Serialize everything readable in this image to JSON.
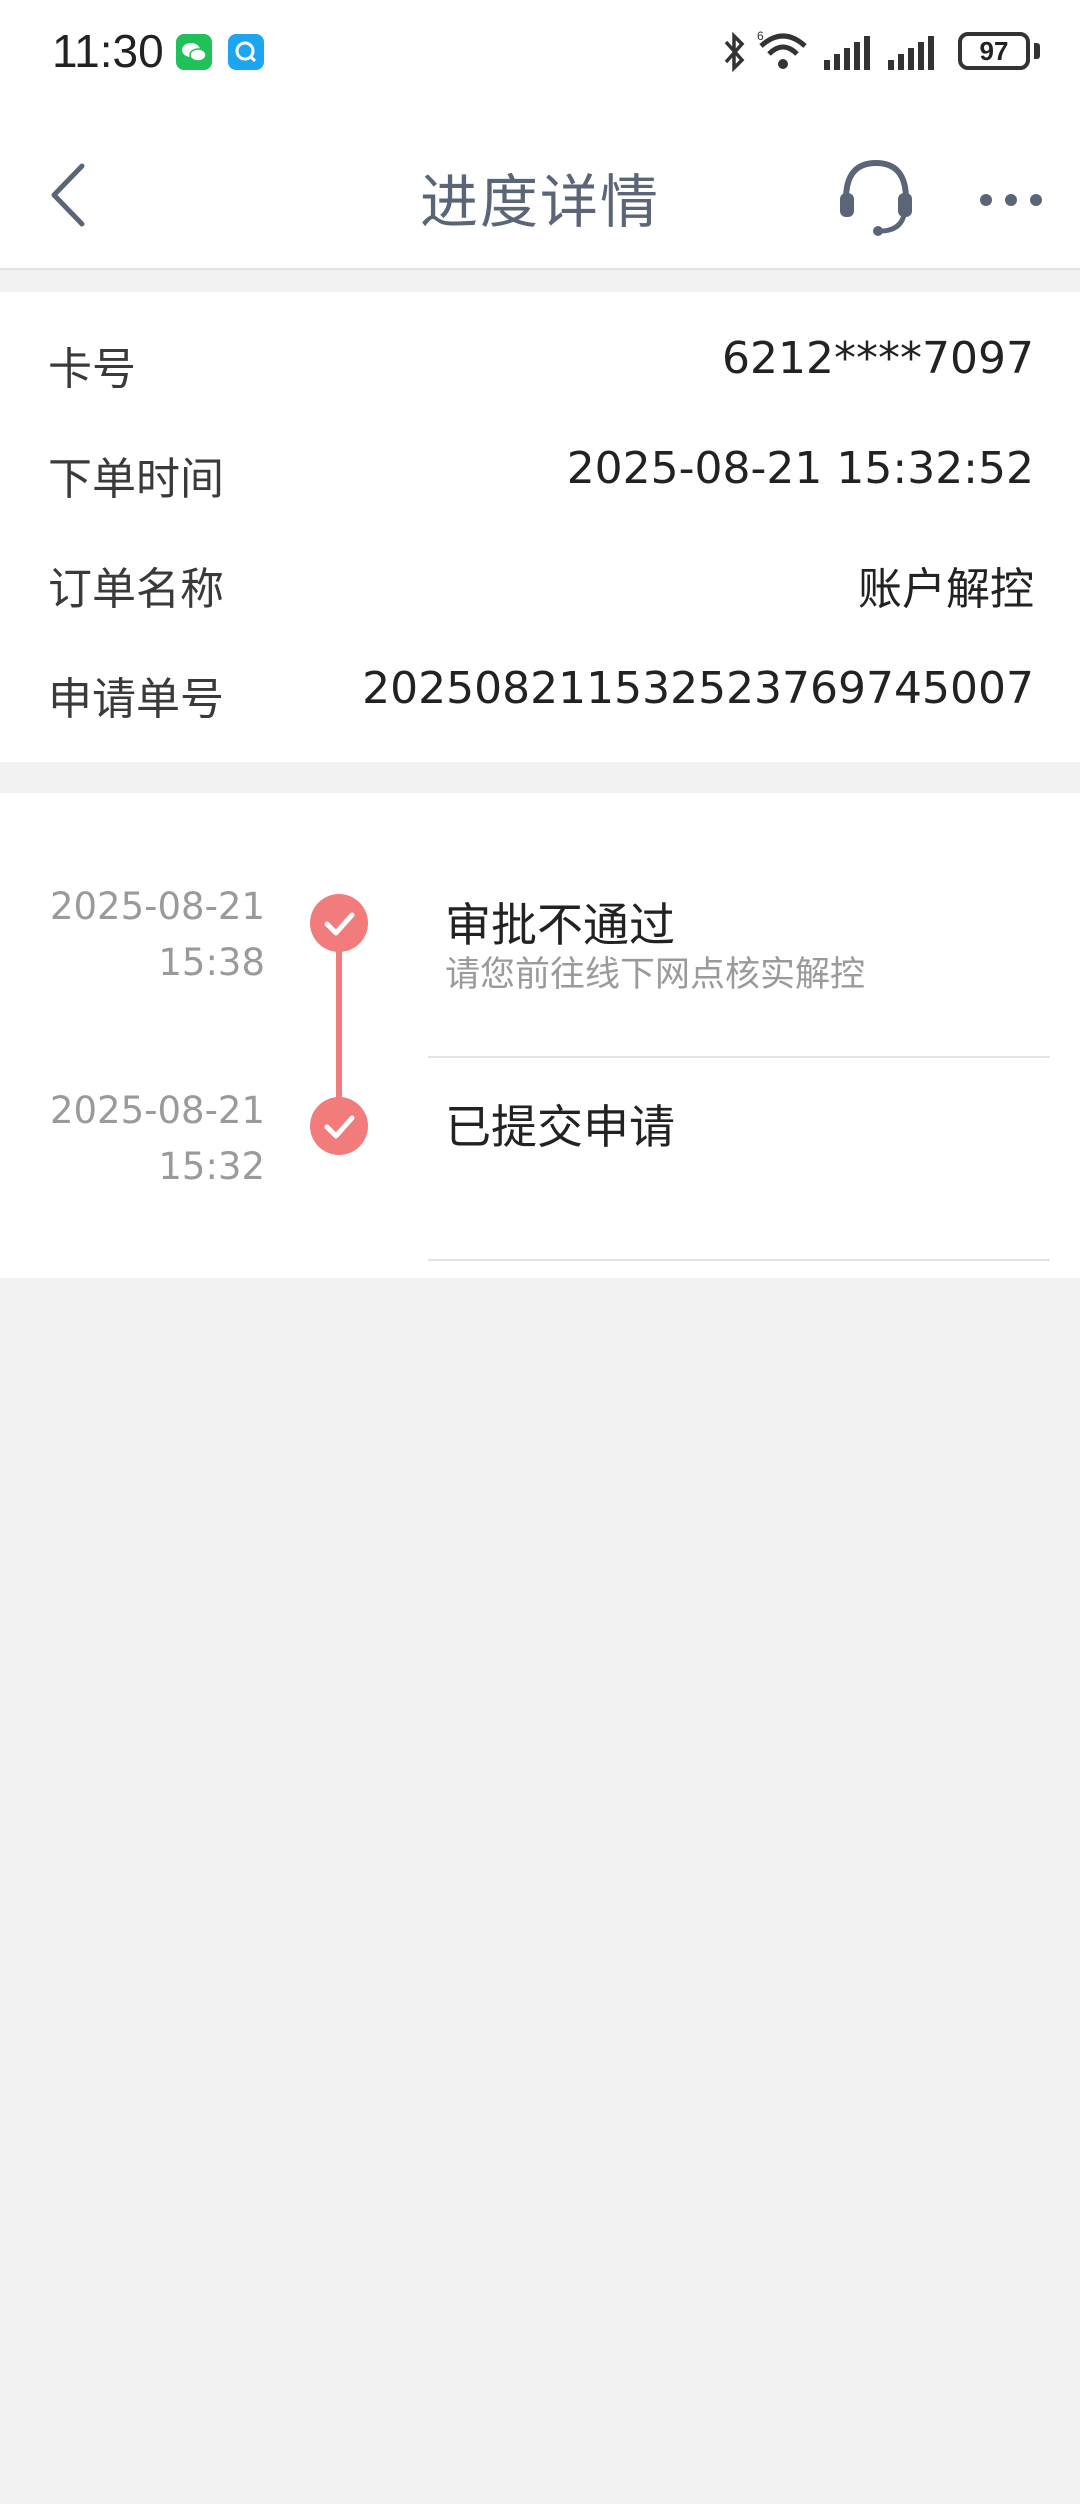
{
  "status_bar": {
    "time": "11:30",
    "apps": [
      "wechat-icon",
      "search-app-icon"
    ],
    "battery": "97"
  },
  "nav": {
    "title": "进度详情",
    "back_icon": "chevron-left-icon",
    "support_icon": "headset-icon",
    "more_icon": "more-dots-icon"
  },
  "info": {
    "rows": [
      {
        "label": "卡号",
        "value": "6212****7097"
      },
      {
        "label": "下单时间",
        "value": "2025-08-21 15:32:52"
      },
      {
        "label": "订单名称",
        "value": "账户解控"
      },
      {
        "label": "申请单号",
        "value": "20250821153252376974 5007"
      }
    ]
  },
  "timeline": {
    "accent": "#f27c7c",
    "items": [
      {
        "date": "2025-08-21",
        "time": "15:38",
        "title": "审批不通过",
        "subtitle": "请您前往线下网点核实解控"
      },
      {
        "date": "2025-08-21",
        "time": "15:32",
        "title": "已提交申请",
        "subtitle": ""
      }
    ]
  }
}
